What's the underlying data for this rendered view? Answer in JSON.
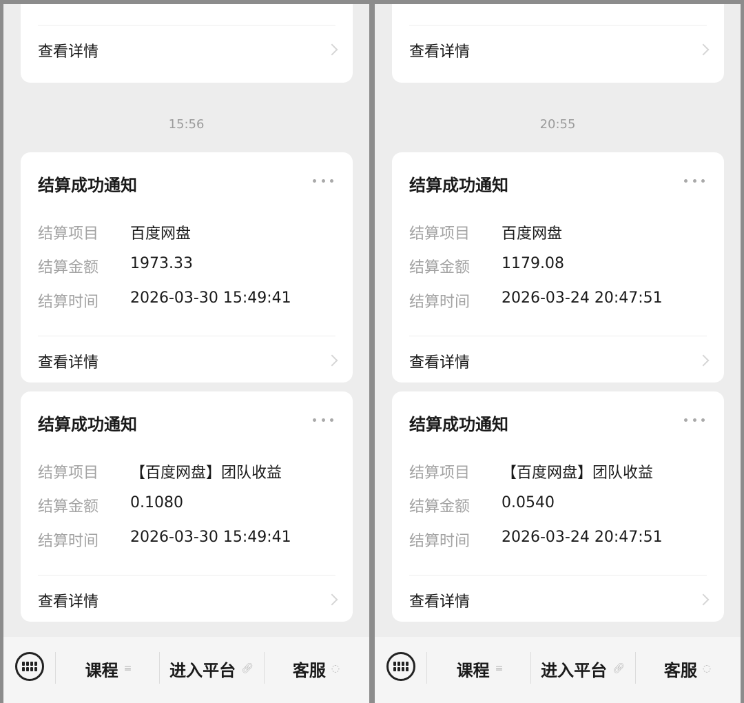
{
  "panels": [
    {
      "top_card": {
        "detail_label": "查看详情"
      },
      "time": "15:56",
      "cards": [
        {
          "title": "结算成功通知",
          "rows": [
            {
              "label": "结算项目",
              "value": "百度网盘"
            },
            {
              "label": "结算金额",
              "value": "1973.33"
            },
            {
              "label": "结算时间",
              "value": "2026-03-30 15:49:41"
            }
          ],
          "detail_label": "查看详情"
        },
        {
          "title": "结算成功通知",
          "rows": [
            {
              "label": "结算项目",
              "value": "【百度网盘】团队收益"
            },
            {
              "label": "结算金额",
              "value": "0.1080"
            },
            {
              "label": "结算时间",
              "value": "2026-03-30 15:49:41"
            }
          ],
          "detail_label": "查看详情"
        }
      ],
      "menu": [
        {
          "label": "课程",
          "icon": "≡"
        },
        {
          "label": "进入平台",
          "icon": "🔗︎"
        },
        {
          "label": "客服",
          "icon": "◌"
        }
      ]
    },
    {
      "top_card": {
        "detail_label": "查看详情"
      },
      "time": "20:55",
      "cards": [
        {
          "title": "结算成功通知",
          "rows": [
            {
              "label": "结算项目",
              "value": "百度网盘"
            },
            {
              "label": "结算金额",
              "value": "1179.08"
            },
            {
              "label": "结算时间",
              "value": "2026-03-24 20:47:51"
            }
          ],
          "detail_label": "查看详情"
        },
        {
          "title": "结算成功通知",
          "rows": [
            {
              "label": "结算项目",
              "value": "【百度网盘】团队收益"
            },
            {
              "label": "结算金额",
              "value": "0.0540"
            },
            {
              "label": "结算时间",
              "value": "2026-03-24 20:47:51"
            }
          ],
          "detail_label": "查看详情"
        }
      ],
      "menu": [
        {
          "label": "课程",
          "icon": "≡"
        },
        {
          "label": "进入平台",
          "icon": "🔗︎"
        },
        {
          "label": "客服",
          "icon": "◌"
        }
      ]
    }
  ]
}
